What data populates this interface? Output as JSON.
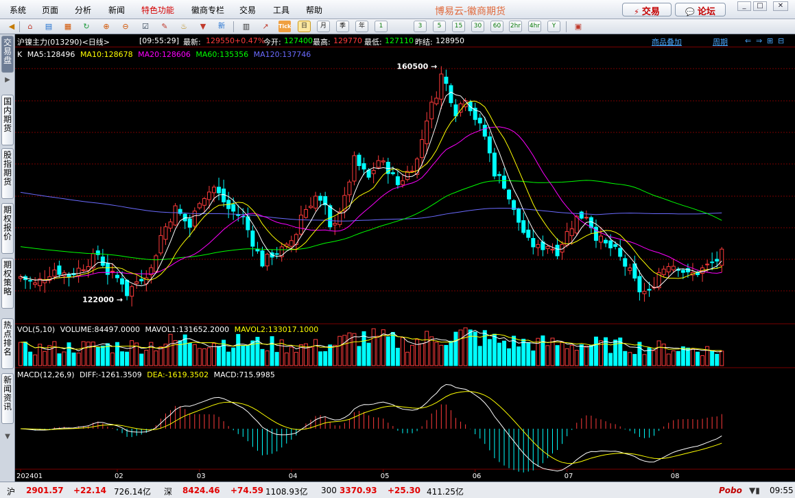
{
  "menubar": {
    "items": [
      "系统",
      "页面",
      "分析",
      "新闻",
      "特色功能",
      "徽商专栏",
      "交易",
      "工具",
      "帮助"
    ],
    "highlight_index": 4,
    "app_title": "博易云-徽商期货",
    "trade_button": "交易",
    "forum_button": "论坛"
  },
  "toolbar": {
    "periods": [
      "日",
      "月",
      "季",
      "年",
      "1",
      "3",
      "5",
      "15",
      "30",
      "60",
      "2hr",
      "4hr",
      "Y"
    ],
    "selected_period": "日",
    "tick_label": "Tick",
    "new_label": "新"
  },
  "left_tabs": [
    {
      "label": "交易盘",
      "active": true
    },
    {
      "label": "国内期货",
      "active": false
    },
    {
      "label": "股指期货",
      "active": false
    },
    {
      "label": "期权报价",
      "active": false
    },
    {
      "label": "期权策略",
      "active": false
    },
    {
      "label": "热点排名",
      "active": false
    },
    {
      "label": "新闻资讯",
      "active": false
    }
  ],
  "quote": {
    "name": "沪镍主力(013290)<日线>",
    "time": "[09:55:29]",
    "last_label": "最新:",
    "last_value": "129550",
    "change_pct": "+0.47%",
    "open_label": "今开:",
    "open_value": "127400",
    "high_label": "最高:",
    "high_value": "129770",
    "low_label": "最低:",
    "low_value": "127110",
    "prev_close_label": "昨结:",
    "prev_close_value": "128950",
    "overlay_link": "商品叠加",
    "period_link": "周期"
  },
  "ma_legend": [
    {
      "text": "K",
      "color": "#ffffff"
    },
    {
      "text": "MA5:128496",
      "color": "#ffffff"
    },
    {
      "text": "MA10:128678",
      "color": "#ffff00"
    },
    {
      "text": "MA20:128606",
      "color": "#ff00ff"
    },
    {
      "text": "MA60:135356",
      "color": "#00ff00"
    },
    {
      "text": "MA120:137746",
      "color": "#6b6bff"
    }
  ],
  "vol_legend": [
    {
      "text": "VOL(5,10)",
      "color": "#ffffff"
    },
    {
      "text": "VOLUME:84497.0000",
      "color": "#ffffff"
    },
    {
      "text": "MAVOL1:131652.2000",
      "color": "#ffffff"
    },
    {
      "text": "MAVOL2:133017.1000",
      "color": "#ffff00"
    }
  ],
  "macd_legend": [
    {
      "text": "MACD(12,26,9)",
      "color": "#ffffff"
    },
    {
      "text": "DIFF:-1261.3509",
      "color": "#ffffff"
    },
    {
      "text": "DEA:-1619.3502",
      "color": "#ffff00"
    },
    {
      "text": "MACD:715.9985",
      "color": "#ffffff"
    }
  ],
  "colors": {
    "up": "#ff3b3b",
    "down": "#00ffff",
    "grid": "#7a0000",
    "ma5": "#ffffff",
    "ma10": "#ffff00",
    "ma20": "#ff00ff",
    "ma60": "#00ff00",
    "ma120": "#6b6bff"
  },
  "chart_data": {
    "type": "candlestick",
    "instrument": "沪镍主力",
    "interval": "日线",
    "y_range": [
      118000,
      163500
    ],
    "annotations": [
      {
        "text": "160500",
        "value": 160500,
        "kind": "high"
      },
      {
        "text": "122000",
        "value": 122000,
        "kind": "low"
      }
    ],
    "x_tick_labels": [
      {
        "label": "202401",
        "index": 0
      },
      {
        "label": "02",
        "index": 20
      },
      {
        "label": "03",
        "index": 37
      },
      {
        "label": "04",
        "index": 56
      },
      {
        "label": "05",
        "index": 75
      },
      {
        "label": "06",
        "index": 94
      },
      {
        "label": "07",
        "index": 113
      },
      {
        "label": "08",
        "index": 135
      }
    ],
    "close_anchors": [
      [
        0,
        125800
      ],
      [
        3,
        124500
      ],
      [
        7,
        127000
      ],
      [
        10,
        126000
      ],
      [
        13,
        127500
      ],
      [
        16,
        129500
      ],
      [
        18,
        126500
      ],
      [
        21,
        125000
      ],
      [
        22,
        123000
      ],
      [
        24,
        125000
      ],
      [
        27,
        127000
      ],
      [
        29,
        132500
      ],
      [
        32,
        137000
      ],
      [
        35,
        134000
      ],
      [
        37,
        138500
      ],
      [
        40,
        140500
      ],
      [
        43,
        137000
      ],
      [
        46,
        135500
      ],
      [
        48,
        131500
      ],
      [
        50,
        128000
      ],
      [
        52,
        129500
      ],
      [
        55,
        130500
      ],
      [
        57,
        133000
      ],
      [
        58,
        136000
      ],
      [
        61,
        139000
      ],
      [
        63,
        137000
      ],
      [
        64,
        133500
      ],
      [
        67,
        138500
      ],
      [
        69,
        145000
      ],
      [
        72,
        142000
      ],
      [
        74,
        145000
      ],
      [
        76,
        143500
      ],
      [
        78,
        141000
      ],
      [
        80,
        143000
      ],
      [
        82,
        145000
      ],
      [
        84,
        152000
      ],
      [
        86,
        156000
      ],
      [
        87,
        159000
      ],
      [
        88,
        157500
      ],
      [
        90,
        153000
      ],
      [
        92,
        155500
      ],
      [
        94,
        152000
      ],
      [
        96,
        149000
      ],
      [
        98,
        143000
      ],
      [
        100,
        141000
      ],
      [
        102,
        136500
      ],
      [
        105,
        131500
      ],
      [
        107,
        130500
      ],
      [
        109,
        131000
      ],
      [
        111,
        130000
      ],
      [
        113,
        133000
      ],
      [
        115,
        135500
      ],
      [
        117,
        136000
      ],
      [
        119,
        132500
      ],
      [
        121,
        131000
      ],
      [
        123,
        130000
      ],
      [
        126,
        126500
      ],
      [
        128,
        123500
      ],
      [
        130,
        123000
      ],
      [
        132,
        126500
      ],
      [
        134,
        128000
      ],
      [
        136,
        127500
      ],
      [
        138,
        126000
      ],
      [
        140,
        126500
      ],
      [
        142,
        127500
      ],
      [
        144,
        128500
      ],
      [
        145,
        129550
      ]
    ],
    "volume_y_range": [
      0,
      200000
    ],
    "volume_anchors": [
      [
        0,
        100000
      ],
      [
        10,
        110000
      ],
      [
        25,
        120000
      ],
      [
        35,
        155000
      ],
      [
        46,
        135000
      ],
      [
        55,
        120000
      ],
      [
        63,
        115000
      ],
      [
        70,
        175000
      ],
      [
        80,
        135000
      ],
      [
        86,
        170000
      ],
      [
        92,
        185000
      ],
      [
        100,
        140000
      ],
      [
        110,
        130000
      ],
      [
        120,
        125000
      ],
      [
        130,
        110000
      ],
      [
        140,
        100000
      ],
      [
        145,
        84497
      ]
    ],
    "macd_y_range": [
      -4500,
      4500
    ],
    "macd_latest": {
      "diff": -1261.3509,
      "dea": -1619.3502,
      "macd": 715.9985
    }
  },
  "statusbar": {
    "sh_label": "沪",
    "sh_index": "2901.57",
    "sh_change": "+22.14",
    "sh_amount": "726.14亿",
    "sz_label": "深",
    "sz_index": "8424.46",
    "sz_change": "+74.59",
    "sz_amount": "1108.93亿",
    "hs300_label": "300",
    "hs300_index": "3370.93",
    "hs300_change": "+25.30",
    "hs300_amount": "411.25亿",
    "brand": "Pobo",
    "clock": "09:55"
  }
}
